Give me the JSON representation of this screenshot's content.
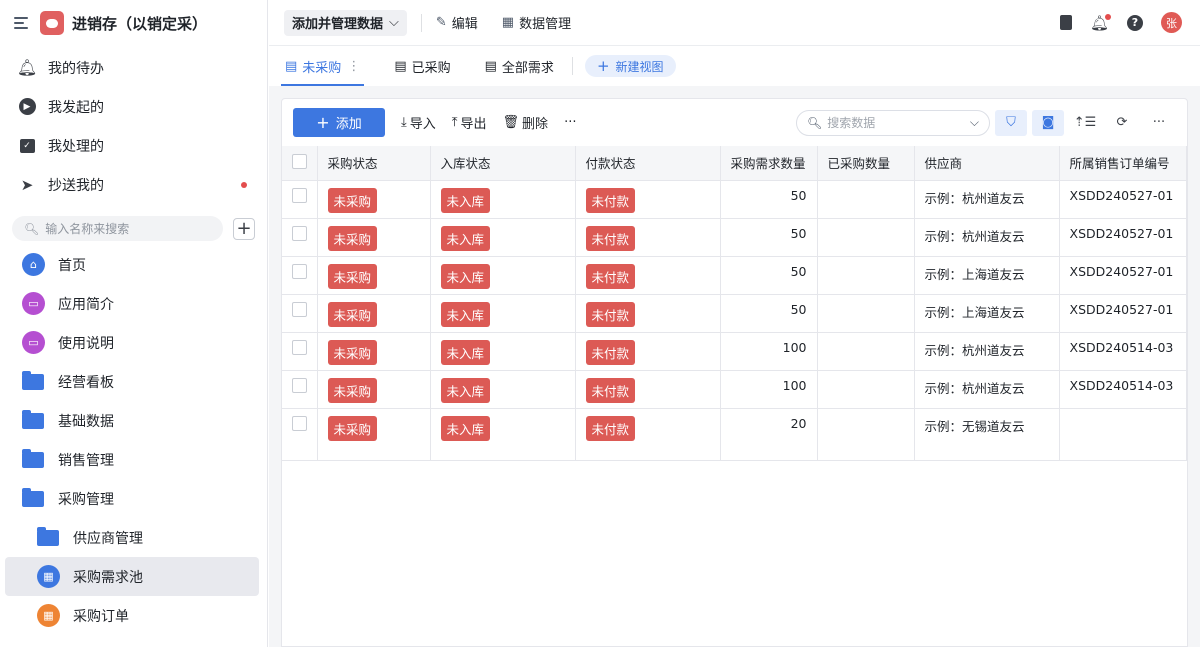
{
  "app": {
    "title": "进销存（以销定采）"
  },
  "quick_nav": [
    {
      "label": "我的待办",
      "icon": "bell-icon"
    },
    {
      "label": "我发起的",
      "icon": "play-icon"
    },
    {
      "label": "我处理的",
      "icon": "inbox-check-icon"
    },
    {
      "label": "抄送我的",
      "icon": "send-icon"
    }
  ],
  "sidebar_search": {
    "placeholder": "输入名称来搜索"
  },
  "tree": [
    {
      "label": "首页"
    },
    {
      "label": "应用简介"
    },
    {
      "label": "使用说明"
    },
    {
      "label": "经营看板"
    },
    {
      "label": "基础数据"
    },
    {
      "label": "销售管理"
    },
    {
      "label": "采购管理"
    },
    {
      "label": "供应商管理"
    },
    {
      "label": "采购需求池"
    },
    {
      "label": "采购订单"
    }
  ],
  "topbar": {
    "add_manage": "添加并管理数据",
    "edit": "编辑",
    "data_manage": "数据管理",
    "avatar": "张"
  },
  "tabs": [
    {
      "label": "未采购"
    },
    {
      "label": "已采购"
    },
    {
      "label": "全部需求"
    }
  ],
  "new_view": "新建视图",
  "toolbar": {
    "add": "添加",
    "import": "导入",
    "export": "导出",
    "delete": "删除",
    "more": "···",
    "search_placeholder": "搜索数据"
  },
  "table": {
    "columns": [
      "采购状态",
      "入库状态",
      "付款状态",
      "采购需求数量",
      "已采购数量",
      "供应商",
      "所属销售订单编号"
    ],
    "rows": [
      [
        "未采购",
        "未入库",
        "未付款",
        "50",
        "",
        "示例：杭州道友云",
        "XSDD240527-01"
      ],
      [
        "未采购",
        "未入库",
        "未付款",
        "50",
        "",
        "示例：杭州道友云",
        "XSDD240527-01"
      ],
      [
        "未采购",
        "未入库",
        "未付款",
        "50",
        "",
        "示例：上海道友云",
        "XSDD240527-01"
      ],
      [
        "未采购",
        "未入库",
        "未付款",
        "50",
        "",
        "示例：上海道友云",
        "XSDD240527-01"
      ],
      [
        "未采购",
        "未入库",
        "未付款",
        "100",
        "",
        "示例：杭州道友云",
        "XSDD240514-03"
      ],
      [
        "未采购",
        "未入库",
        "未付款",
        "100",
        "",
        "示例：杭州道友云",
        "XSDD240514-03"
      ],
      [
        "未采购",
        "未入库",
        "未付款",
        "20",
        "",
        "示例：无锡道友云",
        ""
      ]
    ]
  },
  "colors": {
    "accent": "#3d77e0",
    "tag": "#dc5a55"
  }
}
